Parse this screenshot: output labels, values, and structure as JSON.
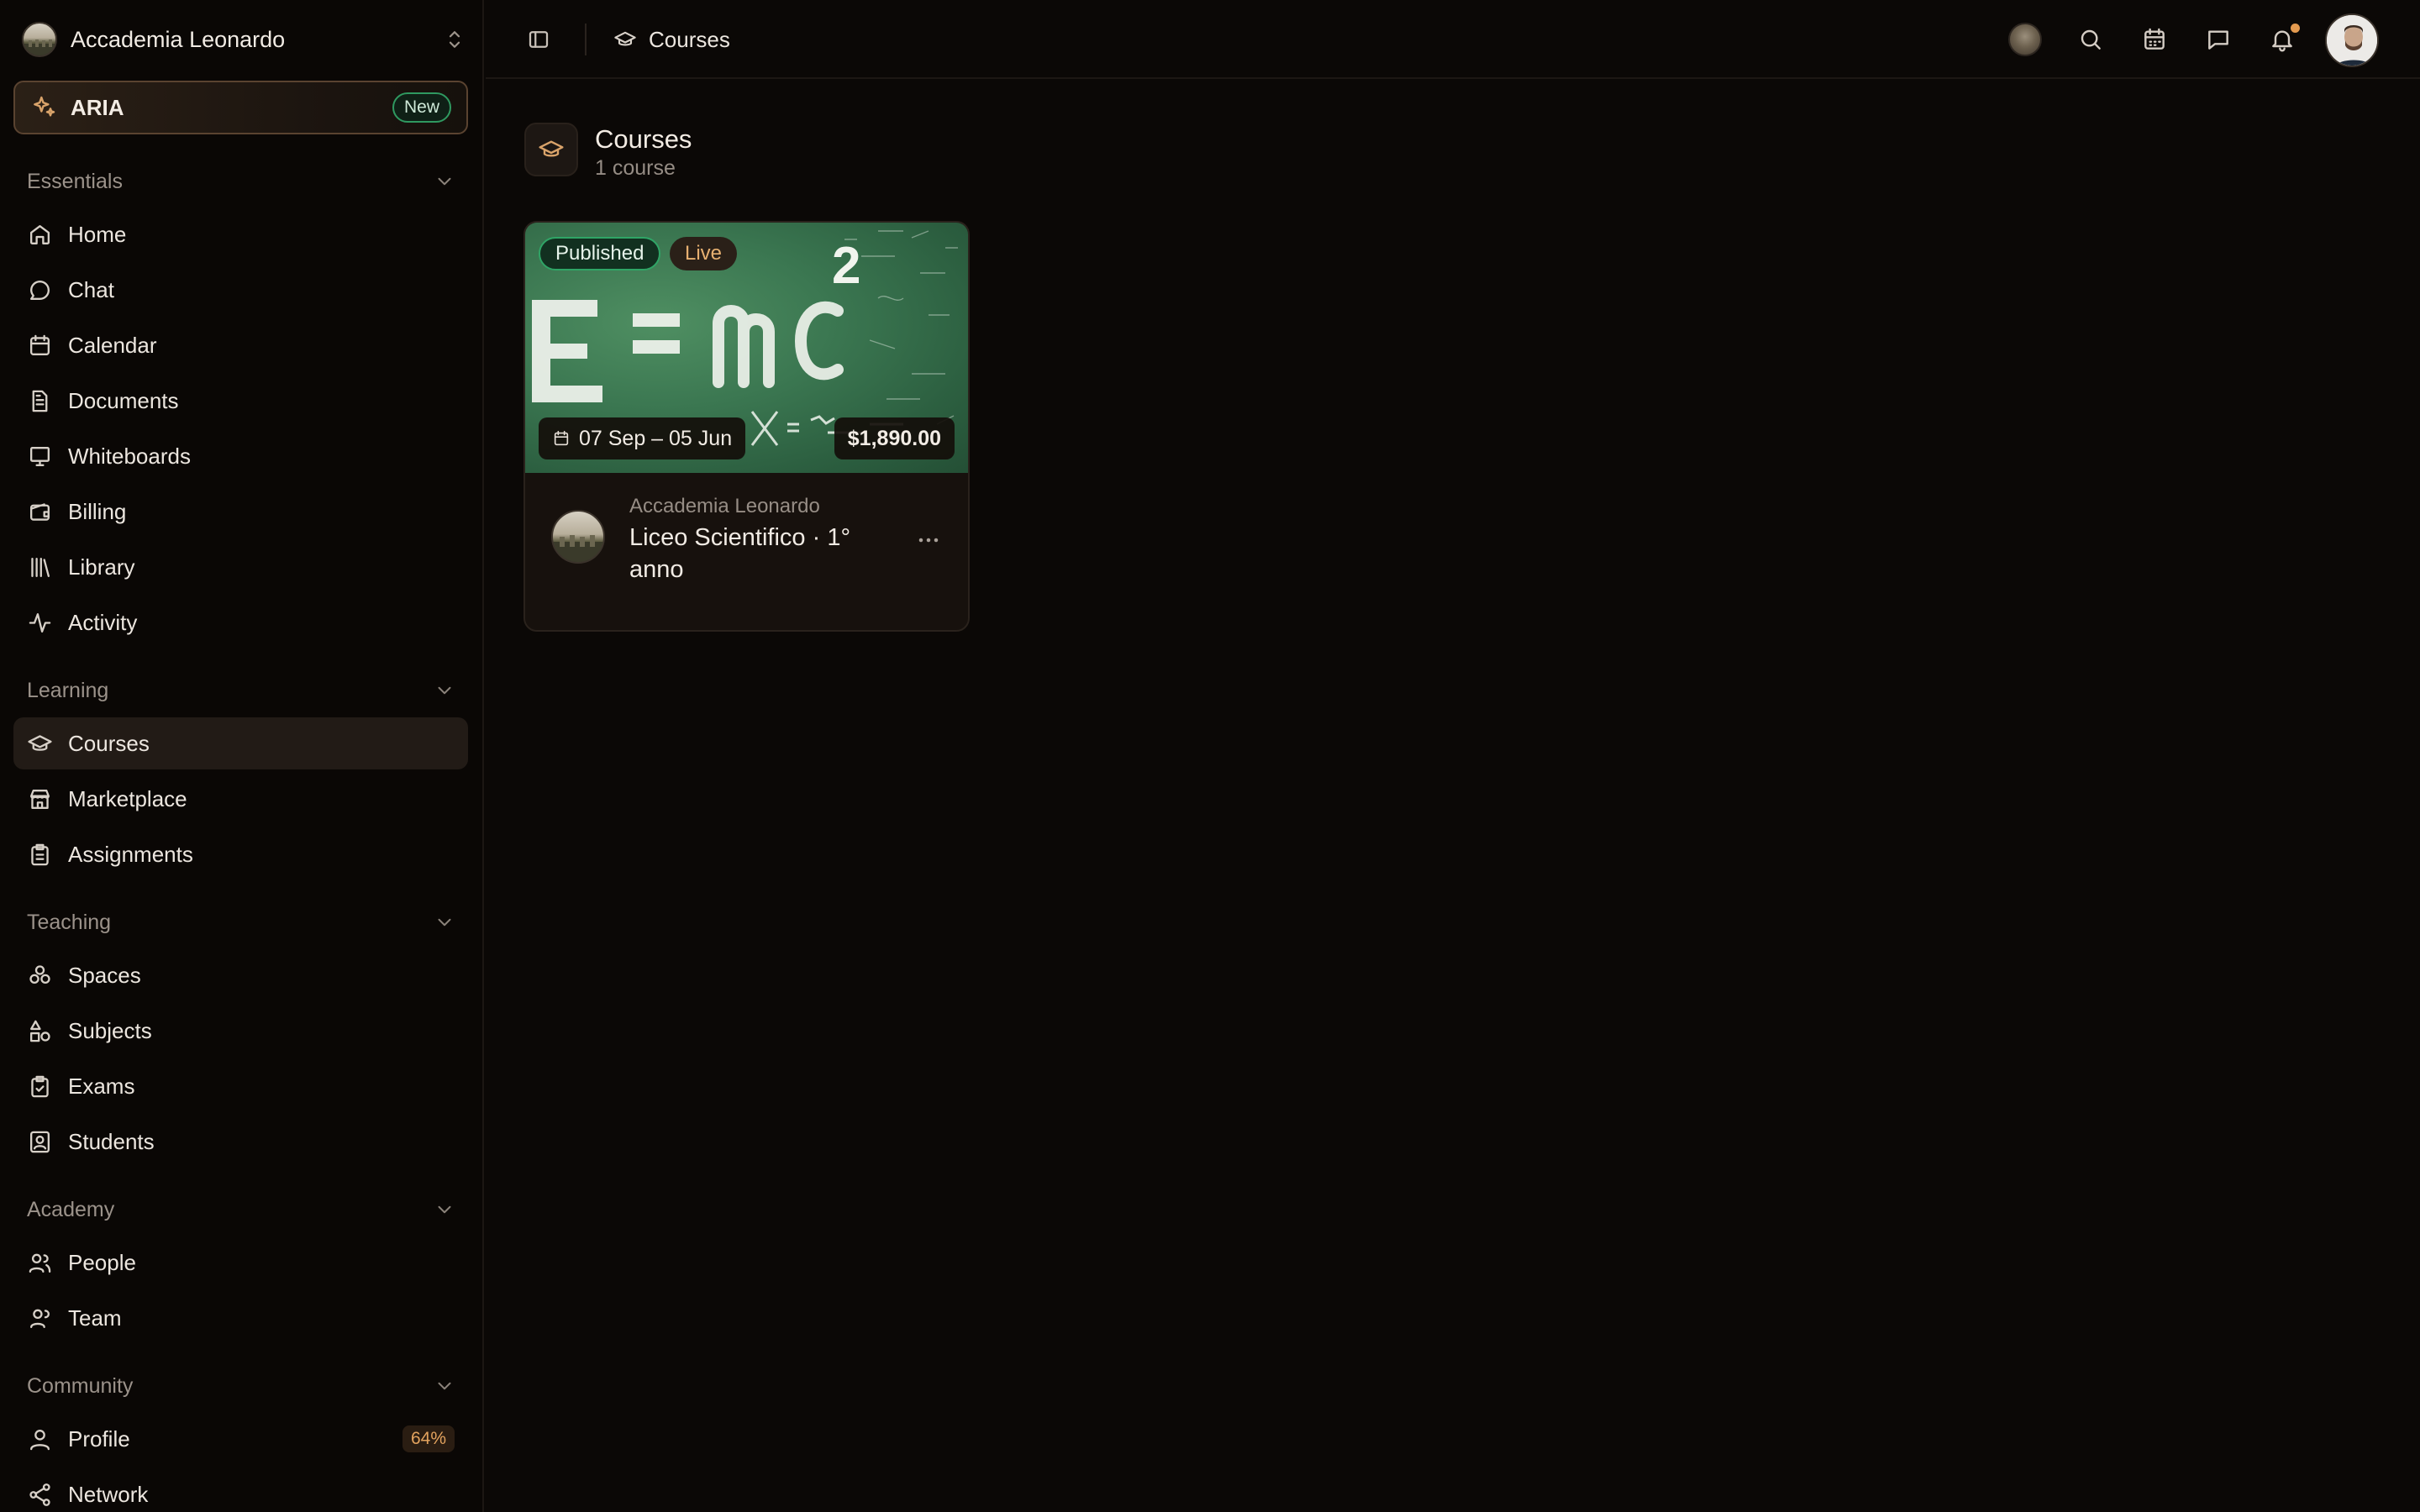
{
  "org": {
    "name": "Accademia Leonardo"
  },
  "aria": {
    "label": "ARIA",
    "badge": "New"
  },
  "sections": {
    "essentials": "Essentials",
    "learning": "Learning",
    "teaching": "Teaching",
    "academy": "Academy",
    "community": "Community"
  },
  "nav": {
    "home": "Home",
    "chat": "Chat",
    "calendar": "Calendar",
    "documents": "Documents",
    "whiteboards": "Whiteboards",
    "billing": "Billing",
    "library": "Library",
    "activity": "Activity",
    "courses": "Courses",
    "marketplace": "Marketplace",
    "assignments": "Assignments",
    "spaces": "Spaces",
    "subjects": "Subjects",
    "exams": "Exams",
    "students": "Students",
    "people": "People",
    "team": "Team",
    "profile": "Profile",
    "profile_badge": "64%",
    "network": "Network"
  },
  "topbar": {
    "breadcrumb": "Courses"
  },
  "page": {
    "title": "Courses",
    "subtitle": "1 course"
  },
  "course": {
    "status": "Published",
    "mode": "Live",
    "dates": "07 Sep – 05 Jun",
    "price": "$1,890.00",
    "org": "Accademia Leonardo",
    "title": "Liceo Scientifico · 1° anno",
    "cover_formula": "E = mc²"
  },
  "colors": {
    "background": "#0b0806",
    "accent": "#d9a36a",
    "published_green": "#2fa566",
    "active_nav": "#221b16"
  }
}
